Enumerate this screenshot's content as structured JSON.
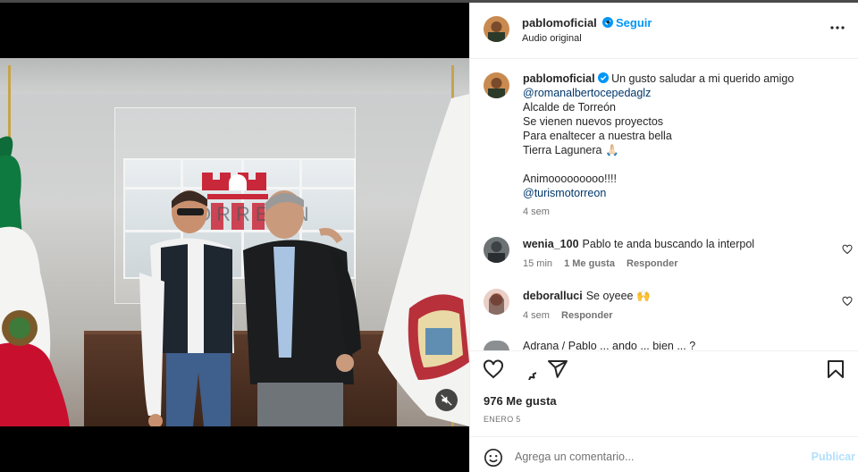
{
  "post": {
    "username": "pablomoficial",
    "follow_label": "Seguir",
    "audio_label": "Audio original",
    "caption_text": "Un gusto saludar a mi querido amigo",
    "caption_mention": "@romanalbertocepedaglz",
    "caption_lines": [
      "Alcalde de Torreón",
      "Se vienen nuevos proyectos",
      "Para enaltecer a nuestra bella",
      "Tierra Lagunera 🙏🏻"
    ],
    "caption_line2": "Animooooooooo!!!!",
    "caption_mention2": "@turismotorreon",
    "caption_time": "4 sem",
    "wall_text": "TORREÓN"
  },
  "comments": [
    {
      "username": "wenia_100",
      "text": "Pablo te anda buscando la interpol",
      "time": "15 min",
      "likes": "1 Me gusta",
      "reply": "Responder"
    },
    {
      "username": "deboralluci",
      "text": "Se oyeee 🙌",
      "time": "4 sem",
      "reply": "Responder"
    },
    {
      "username": "",
      "text": "Adrana / Pablo ... ando ... bien ... ?"
    }
  ],
  "engagement": {
    "likes": "976 Me gusta",
    "date": "ENERO 5"
  },
  "composer": {
    "placeholder": "Agrega un comentario...",
    "publish_label": "Publicar"
  },
  "colors": {
    "accent": "#0095f6",
    "verified": "#0095f6",
    "publish_disabled": "#b2dffc"
  },
  "icons": [
    "verified-icon",
    "more-options-icon",
    "heart-icon",
    "comment-icon",
    "share-icon",
    "save-icon",
    "emoji-icon",
    "mute-icon"
  ]
}
